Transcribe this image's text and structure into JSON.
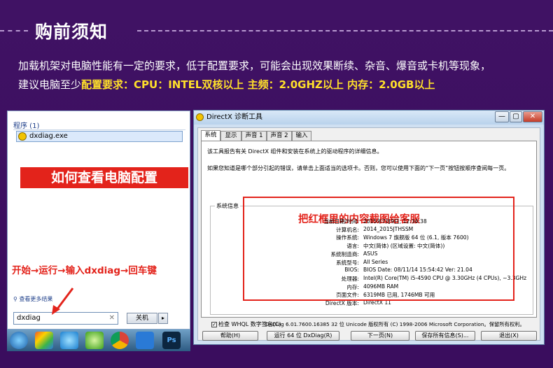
{
  "heading": "购前须知",
  "intro": {
    "line1": "加载机架对电脑性能有一定的要求，低于配置要求，可能会出现效果断续、杂音、爆音或卡机等现象，",
    "line2_prefix": "建议电脑至少",
    "line2_highlight": "配置要求：CPU：INTEL双核以上  主频：2.0GHZ以上  内存：2.0GB以上"
  },
  "start_menu": {
    "group_label": "程序 (1)",
    "result": "dxdiag.exe",
    "howto_title": "如何查看电脑配置",
    "steps": "开始→运行→输入dxdiag→回车键",
    "more_results": "查看更多结果",
    "search_value": "dxdiag",
    "shutdown_label": "关机",
    "shutdown_arrow": "▸"
  },
  "dxdiag": {
    "title": "DirectX 诊断工具",
    "tabs": [
      "系统",
      "显示",
      "声音 1",
      "声音 2",
      "输入"
    ],
    "desc1": "该工具报告有关 DirectX 组件和安装在系统上的驱动程序的详细信息。",
    "desc2": "如果您知道是哪个部分引起的错误，请单击上面适当的选项卡。否则，您可以使用下面的“下一页”按钮按顺序查阅每一页。",
    "section_label": "系统信息",
    "annotation": "把红框里的内容截图给客服",
    "rows": [
      {
        "k": "当前日期/时间:",
        "v": "2015年7月9日, 12:34:38"
      },
      {
        "k": "计算机名:",
        "v": "2014_2015JTHSSM"
      },
      {
        "k": "操作系统:",
        "v": "Windows 7 旗舰版 64 位 (6.1, 版本 7600)"
      },
      {
        "k": "语言:",
        "v": "中文(简体) (区域设置: 中文(简体))"
      },
      {
        "k": "系统制造商:",
        "v": "ASUS"
      },
      {
        "k": "系统型号:",
        "v": "All Series"
      },
      {
        "k": "BIOS:",
        "v": "BIOS Date: 08/11/14 15:54:42 Ver: 21.04"
      },
      {
        "k": "处理器:",
        "v": "Intel(R) Core(TM) i5-4590 CPU @ 3.30GHz (4 CPUs), ~3.3GHz"
      },
      {
        "k": "内存:",
        "v": "4096MB RAM"
      },
      {
        "k": "页面文件:",
        "v": "6319MB 已用, 1746MB 可用"
      },
      {
        "k": "DirectX 版本:",
        "v": "DirectX 11"
      }
    ],
    "checkbox_label": "检查 WHQL 数字签名(C)",
    "checkbox_mark": "✓",
    "copyright": "DxDiag 6.01.7600.16385 32 位 Unicode 版权所有 (C) 1998-2006 Microsoft Corporation。保留所有权利。",
    "buttons": {
      "help": "帮助(H)",
      "run64": "运行 64 位 DxDiag(R)",
      "next": "下一页(N)",
      "save": "保存所有信息(S)...",
      "exit": "退出(X)"
    },
    "win_min": "—",
    "win_max": "▢",
    "win_close": "✕"
  },
  "colors": {
    "bg": "#3e0f63",
    "highlight": "#ffe02a",
    "red": "#e3231b"
  }
}
